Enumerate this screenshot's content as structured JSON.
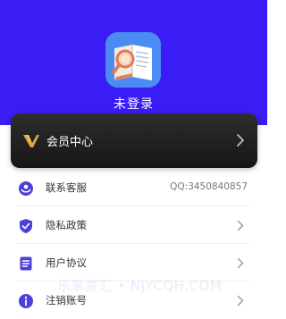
{
  "profile": {
    "status_text": "未登录"
  },
  "vip": {
    "label": "会员中心"
  },
  "menu": {
    "contact": {
      "label": "联系客服",
      "value": "QQ:3450840857"
    },
    "privacy": {
      "label": "隐私政策"
    },
    "agreement": {
      "label": "用户协议"
    },
    "deregister": {
      "label": "注销账号"
    }
  },
  "watermark": {
    "text": "乐享资汇 • NJYCQH.COM"
  },
  "colors": {
    "header_bg": "#3a1cf4",
    "vip_gold": "#d9a441",
    "icon_blue": "#4b40d8"
  },
  "icons": {
    "avatar": "book-magnifier-icon",
    "vip": "vip-v-icon",
    "contact": "headset-icon",
    "privacy": "shield-check-icon",
    "agreement": "document-list-icon",
    "deregister": "info-circle-icon",
    "chevron": "chevron-right-icon"
  }
}
